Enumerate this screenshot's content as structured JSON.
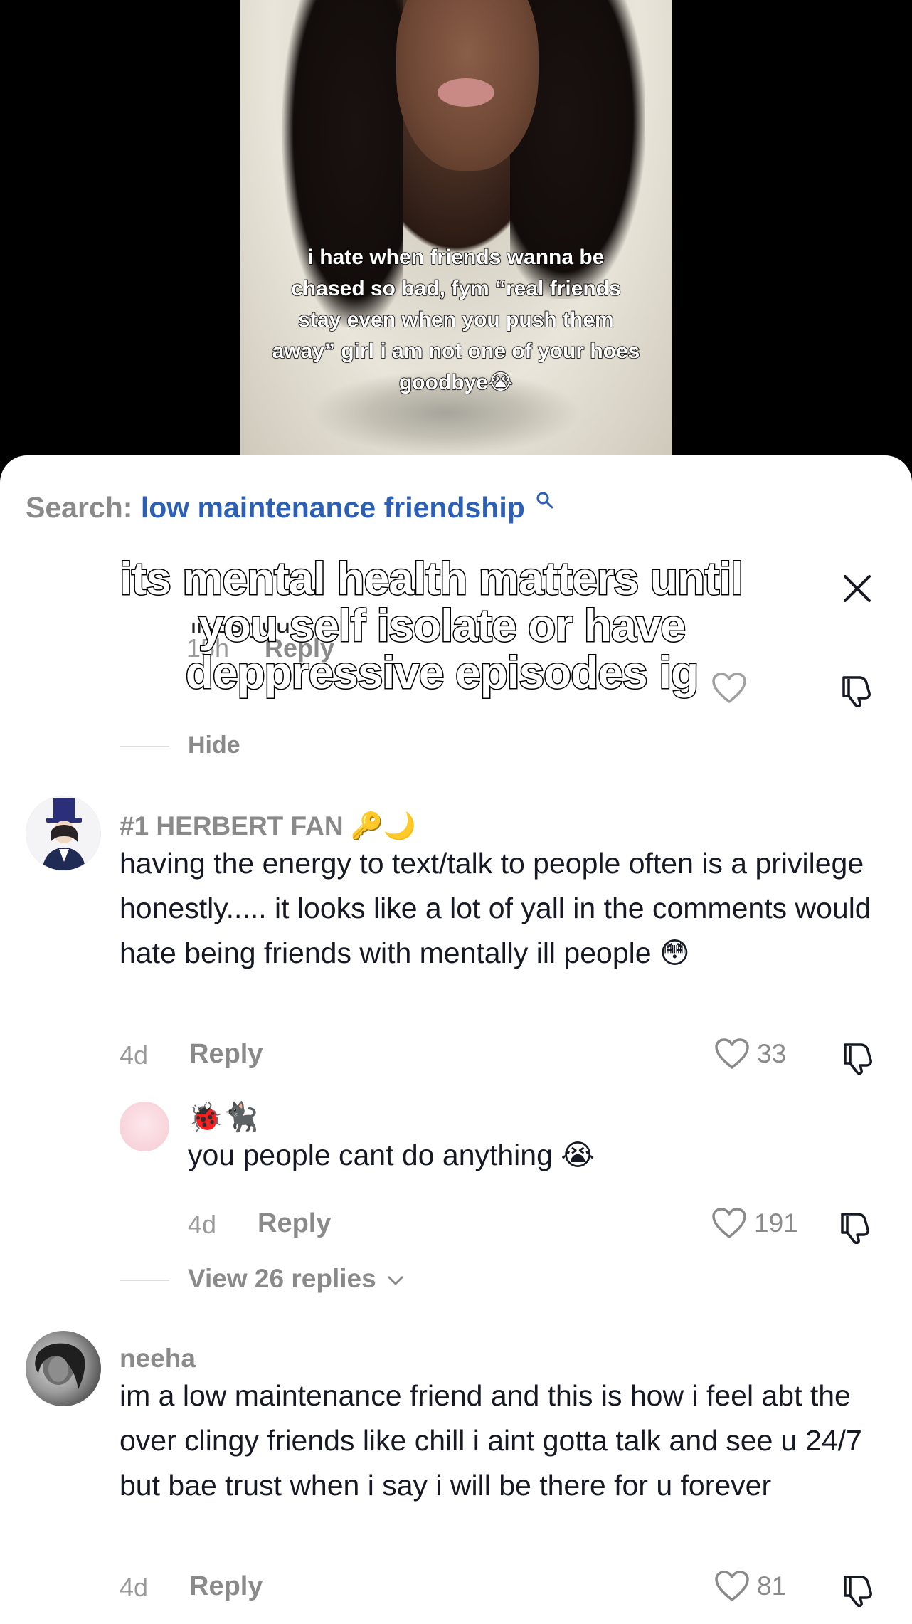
{
  "video": {
    "caption": "i hate when friends wanna be chased so bad, fym “real friends stay even when you push them away” girl i am not one of your hoes goodbye😭"
  },
  "search": {
    "prefix": "Search:",
    "term": "low maintenance friendship"
  },
  "overlay_caption": {
    "line1": "its mental health matters until",
    "line2": "you self isolate or have",
    "line3": "deppressive episodes ig"
  },
  "previous_reply": {
    "text_fragment": "likes you",
    "time": "15h",
    "reply_label": "Reply",
    "hide_label": "Hide"
  },
  "comments": [
    {
      "username": "#1 HERBERT FAN 🔑🌙",
      "text": "having the energy to text/talk to people often is a privilege honestly..... it looks like a lot of yall in the comments would hate being friends with mentally ill people 😳",
      "time": "4d",
      "reply_label": "Reply",
      "likes": "33",
      "reply": {
        "username": "🐞🐈‍⬛",
        "text": "you people cant do anything 😭",
        "time": "4d",
        "reply_label": "Reply",
        "likes": "191"
      },
      "view_replies": "View 26 replies"
    },
    {
      "username": "neeha",
      "text": "im a low maintenance friend and this is how i feel abt the over clingy friends like chill i aint gotta talk and see u 24/7 but bae trust when i say i will be there for u forever",
      "time": "4d",
      "reply_label": "Reply",
      "likes": "81"
    }
  ],
  "colors": {
    "link_blue": "#2d5fb5",
    "muted_gray": "#8a8a8a",
    "text_dark": "#161823"
  }
}
